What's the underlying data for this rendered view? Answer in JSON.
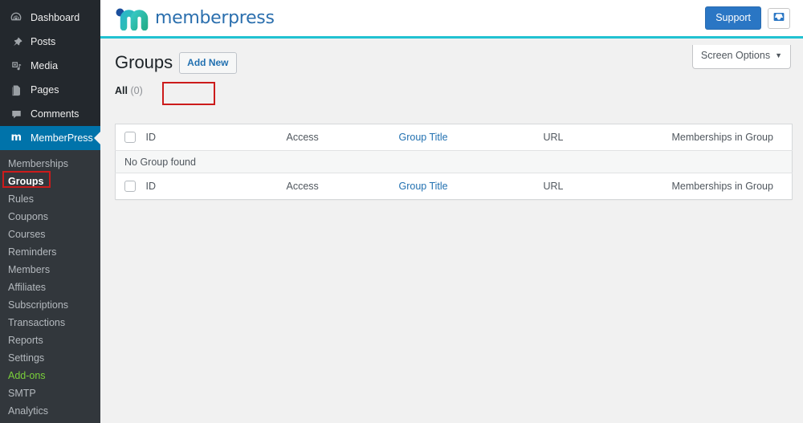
{
  "sidebar": {
    "main_items": [
      {
        "label": "Dashboard",
        "icon": "dashboard-icon",
        "active": false
      },
      {
        "label": "Posts",
        "icon": "pin-icon",
        "active": false
      },
      {
        "label": "Media",
        "icon": "media-icon",
        "active": false
      },
      {
        "label": "Pages",
        "icon": "pages-icon",
        "active": false
      },
      {
        "label": "Comments",
        "icon": "comments-icon",
        "active": false
      },
      {
        "label": "MemberPress",
        "icon": "memberpress-icon",
        "active": true
      }
    ],
    "memberpress_icon_glyph": "m",
    "submenu": [
      {
        "label": "Memberships",
        "state": "normal"
      },
      {
        "label": "Groups",
        "state": "current"
      },
      {
        "label": "Rules",
        "state": "normal"
      },
      {
        "label": "Coupons",
        "state": "normal"
      },
      {
        "label": "Courses",
        "state": "normal"
      },
      {
        "label": "Reminders",
        "state": "normal"
      },
      {
        "label": "Members",
        "state": "normal"
      },
      {
        "label": "Affiliates",
        "state": "normal"
      },
      {
        "label": "Subscriptions",
        "state": "normal"
      },
      {
        "label": "Transactions",
        "state": "normal"
      },
      {
        "label": "Reports",
        "state": "normal"
      },
      {
        "label": "Settings",
        "state": "normal"
      },
      {
        "label": "Add-ons",
        "state": "green"
      },
      {
        "label": "SMTP",
        "state": "normal"
      },
      {
        "label": "Analytics",
        "state": "normal"
      }
    ]
  },
  "header": {
    "brand_word": "memberpress",
    "brand_mark": "memberpress-logo-icon",
    "support_label": "Support",
    "inbox_icon": "inbox-icon"
  },
  "screen_options": {
    "label": "Screen Options",
    "caret": "▼"
  },
  "content": {
    "page_title": "Groups",
    "add_new_label": "Add New",
    "filter": {
      "label": "All",
      "count": "(0)"
    }
  },
  "table": {
    "columns": [
      {
        "key": "cb",
        "label": "",
        "link": false
      },
      {
        "key": "id",
        "label": "ID",
        "link": false
      },
      {
        "key": "access",
        "label": "Access",
        "link": false
      },
      {
        "key": "title",
        "label": "Group Title",
        "link": true
      },
      {
        "key": "url",
        "label": "URL",
        "link": false
      },
      {
        "key": "memb",
        "label": "Memberships in Group",
        "link": false
      }
    ],
    "rows": [],
    "empty_message": "No Group found"
  },
  "colors": {
    "sidebar_bg": "#23282d",
    "submenu_bg": "#32373c",
    "active_menu_bg": "#0073aa",
    "accent_teal": "#21c2d1",
    "link_blue": "#2271b1",
    "support_blue": "#2a76c4",
    "addons_green": "#7ad03a",
    "annotation_red": "#cc1b1b",
    "page_bg": "#f1f1f1"
  }
}
